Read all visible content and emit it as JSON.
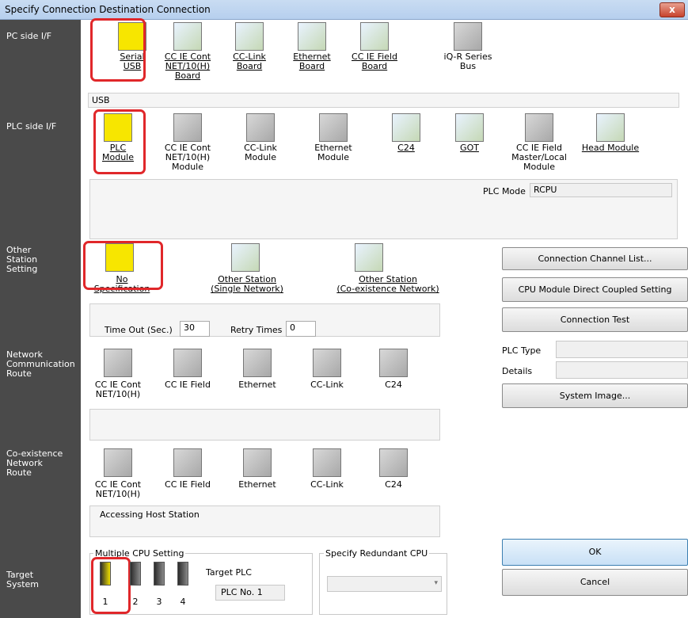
{
  "window": {
    "title": "Specify Connection Destination Connection",
    "close_label": "x"
  },
  "labels": {
    "pc_side": "PC side I/F",
    "plc_side": "PLC side I/F",
    "other_station": "Other\nStation\nSetting",
    "network_route": "Network\nCommunication\nRoute",
    "coexist_route": "Co-existence\nNetwork\nRoute",
    "target_system": "Target\nSystem"
  },
  "pc_side": {
    "items": [
      "Serial\nUSB",
      "CC IE Cont\nNET/10(H)\nBoard",
      "CC-Link\nBoard",
      "Ethernet\nBoard",
      "CC IE Field\nBoard",
      "iQ-R Series\nBus"
    ],
    "selected_text": "USB"
  },
  "plc_side": {
    "items": [
      "PLC\nModule",
      "CC IE Cont\nNET/10(H)\nModule",
      "CC-Link\nModule",
      "Ethernet\nModule",
      "C24",
      "GOT",
      "CC IE Field\nMaster/Local\nModule",
      "Head Module"
    ],
    "plc_mode_label": "PLC Mode",
    "plc_mode_value": "RCPU"
  },
  "other_station": {
    "items": [
      "No Specification",
      "Other Station\n(Single Network)",
      "Other Station\n(Co-existence Network)"
    ],
    "timeout_label": "Time Out (Sec.)",
    "timeout_value": "30",
    "retry_label": "Retry Times",
    "retry_value": "0"
  },
  "network_route": {
    "items": [
      "CC IE Cont\nNET/10(H)",
      "CC IE Field",
      "Ethernet",
      "CC-Link",
      "C24"
    ]
  },
  "coexist_route": {
    "items": [
      "CC IE Cont\nNET/10(H)",
      "CC IE Field",
      "Ethernet",
      "CC-Link",
      "C24"
    ],
    "status_text": "Accessing Host Station"
  },
  "target_system": {
    "multiple_cpu_label": "Multiple CPU Setting",
    "cpu_numbers": [
      "1",
      "2",
      "3",
      "4"
    ],
    "target_plc_label": "Target PLC",
    "target_plc_value": "PLC No. 1",
    "redundant_label": "Specify Redundant CPU"
  },
  "right_panel": {
    "connection_channel_list": "Connection Channel List...",
    "cpu_direct_coupled": "CPU Module Direct Coupled Setting",
    "connection_test": "Connection Test",
    "plc_type_label": "PLC Type",
    "details_label": "Details",
    "system_image": "System Image...",
    "ok": "OK",
    "cancel": "Cancel"
  }
}
